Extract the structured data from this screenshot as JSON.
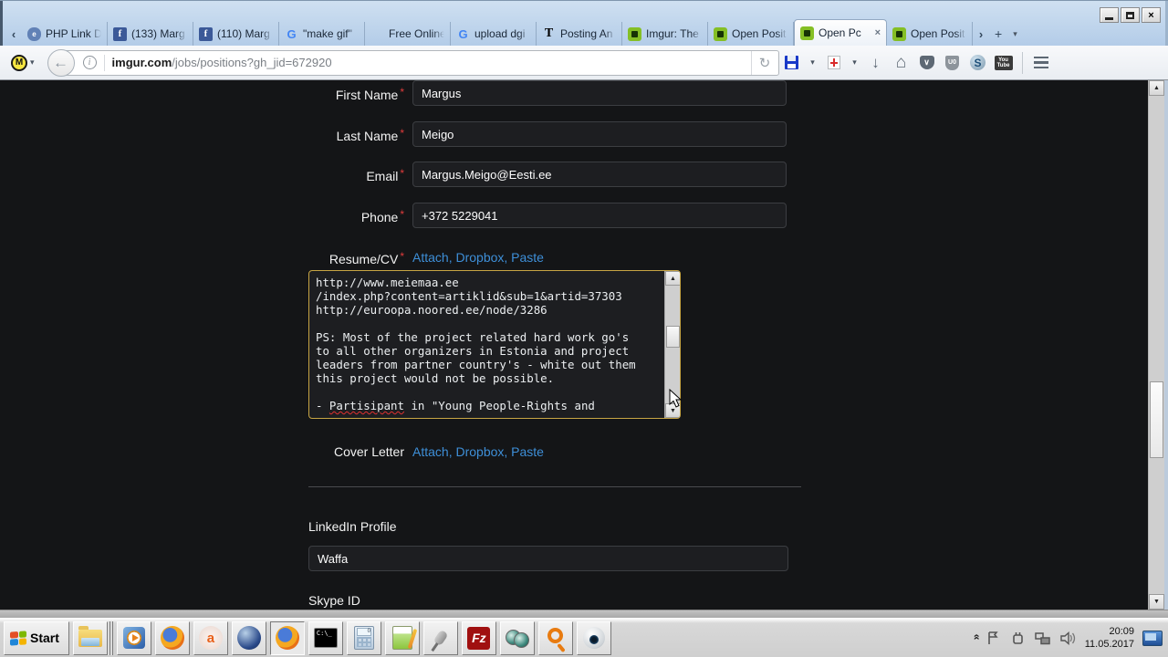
{
  "glyphs": {
    "asterisk": "*",
    "back": "←",
    "reload": "↻",
    "caret": "▾",
    "down_arrow_toolbar": "↓",
    "home": "⌂",
    "info": "i",
    "m_letter": "M",
    "tab_prev": "‹",
    "tab_next": "›",
    "tab_new": "+",
    "tab_close": "×",
    "scroll_up": "▲",
    "scroll_down": "▼",
    "close_window": "×",
    "pocket_chevron": "∨",
    "ublock_text": "U0",
    "skype_letter": "S",
    "youtube_line1": "You",
    "youtube_line2": "Tube",
    "fb_letter": "f",
    "google_letter": "G",
    "nyt_letter": "T",
    "php_letter": "e",
    "cmd_text": "C:\\_",
    "appa_letter": "a",
    "fz_text": "Fz",
    "tray_chevron": "»"
  },
  "browser": {
    "tabs": [
      {
        "label": "PHP Link D"
      },
      {
        "label": "(133) Marg"
      },
      {
        "label": "(110) Marg"
      },
      {
        "label": "\"make gif\""
      },
      {
        "label": "Free Online Ani"
      },
      {
        "label": "upload dgi"
      },
      {
        "label": "Posting An"
      },
      {
        "label": "Imgur: The"
      },
      {
        "label": "Open Posit"
      },
      {
        "label": "Open Pc"
      },
      {
        "label": "Open Posit"
      }
    ],
    "url": {
      "domain": "imgur.com",
      "path": "/jobs/positions?gh_jid=672920"
    }
  },
  "form": {
    "fields": [
      {
        "label": "First Name",
        "value": "Margus"
      },
      {
        "label": "Last Name",
        "value": "Meigo"
      },
      {
        "label": "Email",
        "value": "Margus.Meigo@Eesti.ee"
      },
      {
        "label": "Phone",
        "value": "+372 5229041"
      }
    ],
    "resume": {
      "label": "Resume/CV",
      "links": "Attach, Dropbox, Paste",
      "text_before": "http://www.meiemaa.ee\n/index.php?content=artiklid&sub=1&artid=37303\nhttp://euroopa.noored.ee/node/3286\n\nPS: Most of the project related hard work go's\nto all other organizers in Estonia and project\nleaders from partner country's - white out them\nthis project would not be possible.\n\n- ",
      "misspelled": "Partisipant",
      "text_after": " in \"Young People-Rights and"
    },
    "cover_letter": {
      "label": "Cover Letter",
      "links": "Attach, Dropbox, Paste"
    },
    "linkedin": {
      "label": "LinkedIn Profile",
      "value": "Waffa"
    },
    "skype": {
      "label": "Skype ID"
    }
  },
  "taskbar": {
    "start_label": "Start",
    "clock_time": "20:09",
    "clock_date": "11.05.2017"
  }
}
